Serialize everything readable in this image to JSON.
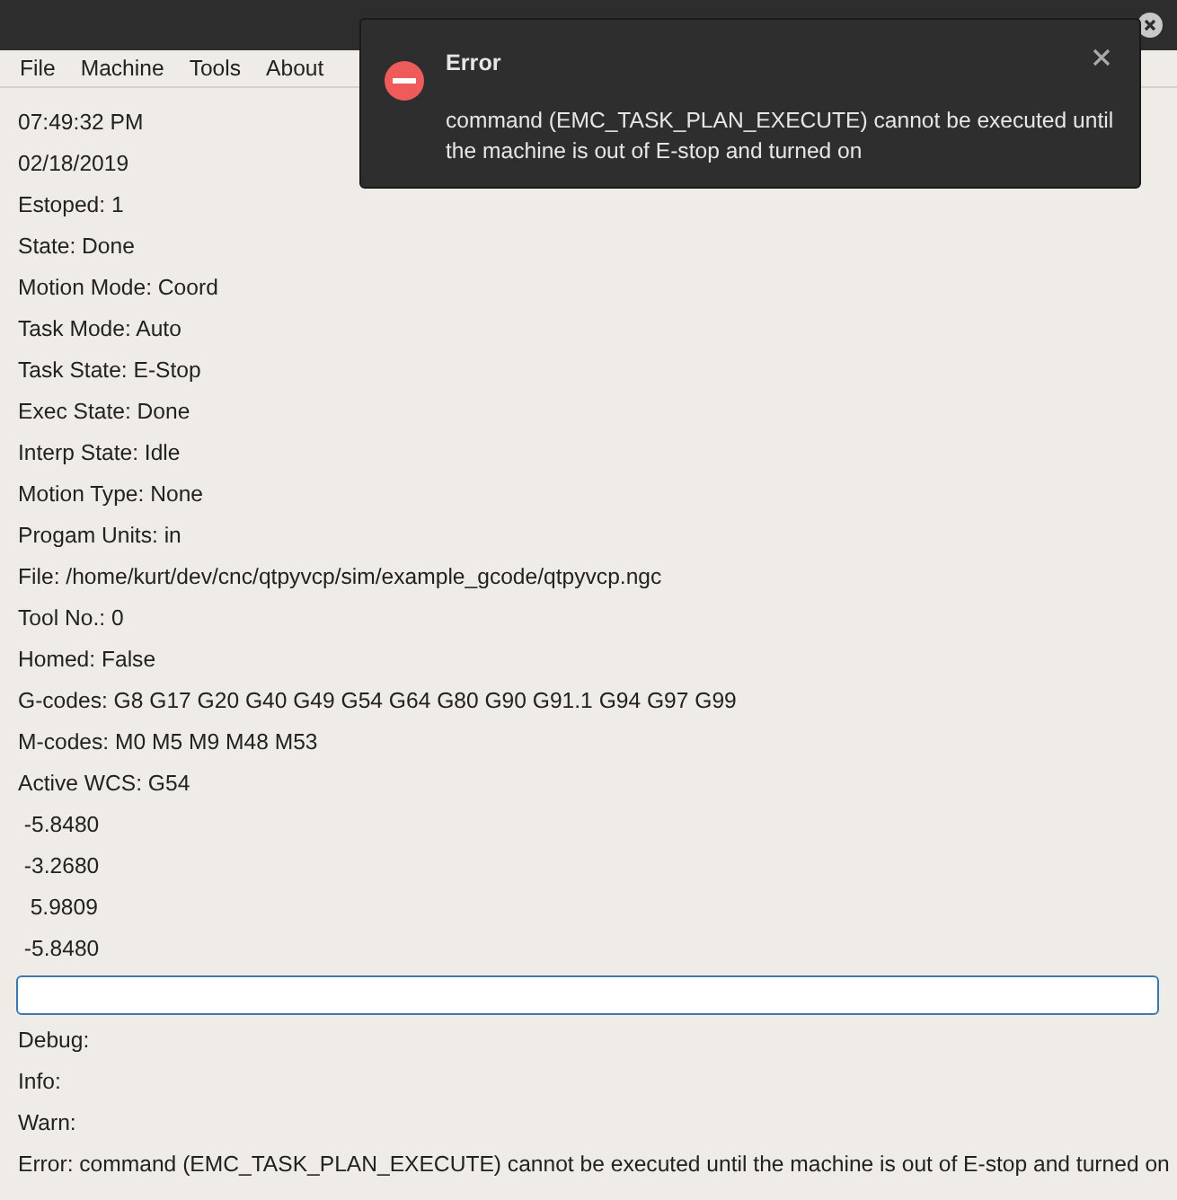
{
  "menu": [
    "File",
    "Machine",
    "Tools",
    "About"
  ],
  "status_lines": [
    "07:49:32 PM",
    "02/18/2019",
    "Estoped: 1",
    "State: Done",
    "Motion Mode: Coord",
    "Task Mode: Auto",
    "Task State: E-Stop",
    "Exec State: Done",
    "Interp State: Idle",
    "Motion Type: None",
    "Progam Units: in",
    "File: /home/kurt/dev/cnc/qtpyvcp/sim/example_gcode/qtpyvcp.ngc",
    "Tool No.: 0",
    "Homed: False",
    "G-codes: G8 G17 G20 G40 G49 G54 G64 G80 G90 G91.1 G94 G97 G99",
    "M-codes: M0 M5 M9 M48 M53",
    "Active WCS: G54",
    " -5.8480",
    " -3.2680",
    "  5.9809",
    " -5.8480"
  ],
  "log_lines": [
    "Debug:",
    "Info:",
    "Warn:",
    "Error: command (EMC_TASK_PLAN_EXECUTE) cannot be executed until the machine is out of E-stop and turned on"
  ],
  "notification": {
    "title": "Error",
    "message": "command (EMC_TASK_PLAN_EXECUTE) cannot be executed until the machine is out of E-stop and turned on"
  }
}
